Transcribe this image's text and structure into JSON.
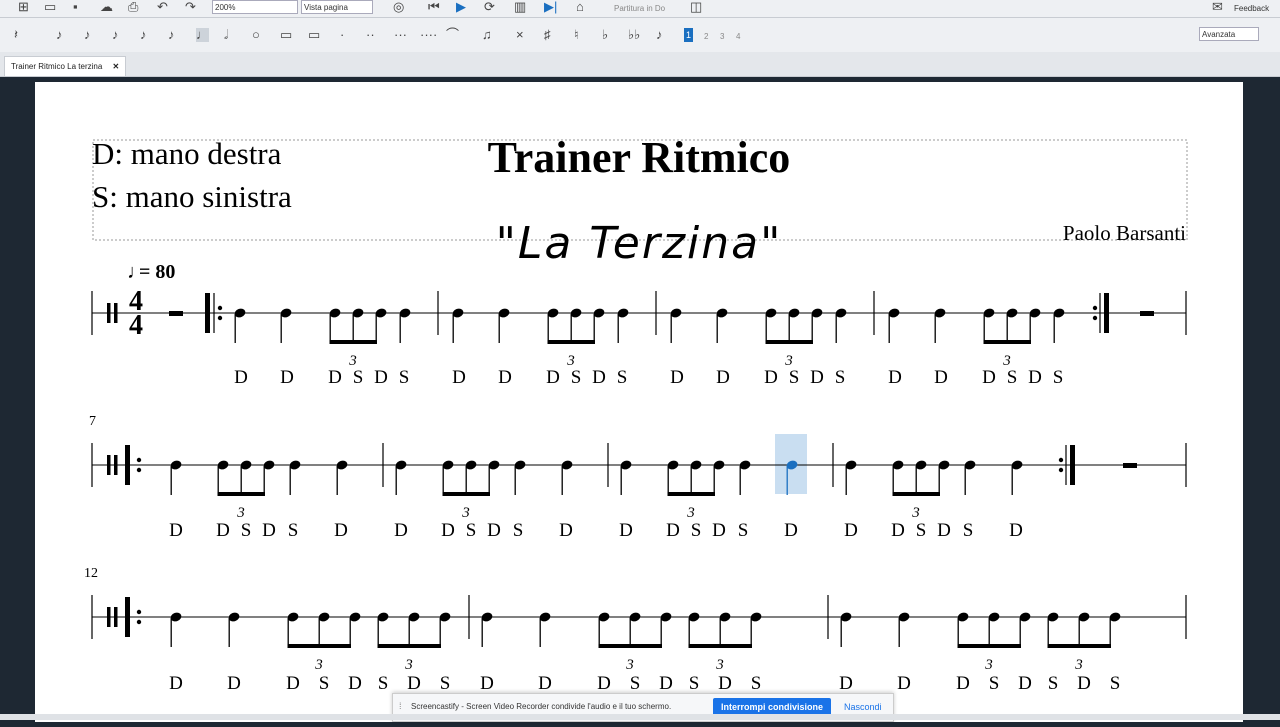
{
  "toolbar": {
    "zoom_value": "200%",
    "view_mode": "Vista pagina",
    "concert_pitch_label": "Partitura in Do",
    "feedback_label": "Feedback",
    "workspace": "Avanzata",
    "voices": [
      "1",
      "2",
      "3",
      "4"
    ]
  },
  "tab": {
    "title": "Trainer Ritmico La terzina",
    "close": "✕"
  },
  "score": {
    "title": "Trainer Ritmico",
    "subtitle": "\"La Terzina\"",
    "left_line1": "D: mano destra",
    "left_line2": "S: mano sinistra",
    "composer": "Paolo Barsanti",
    "tempo_value": "= 80",
    "time_sig_top": "4",
    "time_sig_bottom": "4",
    "measure_number_2": "7",
    "measure_number_3": "12",
    "tuplet": "3"
  },
  "lyrics": {
    "system1": [
      "D",
      "D",
      "D",
      "S",
      "D",
      "S",
      "D",
      "D",
      "D",
      "S",
      "D",
      "S",
      "D",
      "D",
      "D",
      "S",
      "D",
      "S",
      "D",
      "D",
      "D",
      "S",
      "D",
      "S"
    ],
    "system2": [
      "D",
      "D",
      "S",
      "D",
      "S",
      "D",
      "D",
      "D",
      "S",
      "D",
      "S",
      "D",
      "D",
      "D",
      "S",
      "D",
      "S",
      "D",
      "D",
      "D",
      "S",
      "D",
      "S",
      "D"
    ],
    "system3": [
      "D",
      "D",
      "D",
      "S",
      "D",
      "S",
      "D",
      "S",
      "D",
      "D",
      "D",
      "S",
      "D",
      "S",
      "D",
      "S",
      "D",
      "D",
      "D",
      "S",
      "D",
      "S",
      "D",
      "S"
    ]
  },
  "notification": {
    "message": "Screencastify - Screen Video Recorder condivide l'audio e il tuo schermo.",
    "stop_label": "Interrompi condivisione",
    "hide_label": "Nascondi"
  },
  "colors": {
    "paper": "#ffffff",
    "canvas": "#1e2833",
    "selection": "#1a6fc0",
    "button": "#1a73e8"
  }
}
